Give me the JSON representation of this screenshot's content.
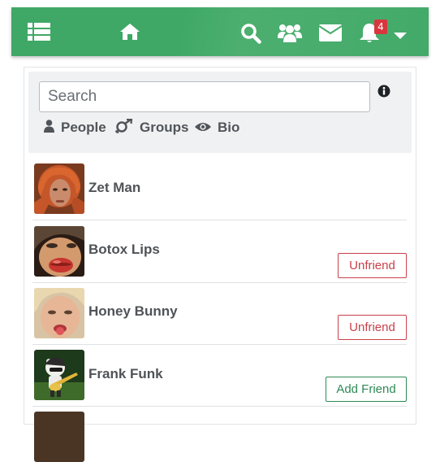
{
  "navbar": {
    "icons": [
      "list-icon",
      "home-icon",
      "search-icon",
      "users-icon",
      "envelope-icon",
      "bell-icon",
      "caret-down-icon"
    ],
    "notification_count": "4",
    "colors": {
      "bar": "#3fa866",
      "badge": "#d9363e"
    }
  },
  "search": {
    "placeholder": "Search",
    "value": ""
  },
  "filters": [
    {
      "label": "People",
      "icon": "user-icon"
    },
    {
      "label": "Groups",
      "icon": "gender-icon"
    },
    {
      "label": "Bio",
      "icon": "eye-icon"
    }
  ],
  "friends": [
    {
      "name": "Zet Man",
      "action": ""
    },
    {
      "name": "Botox Lips",
      "action": "Unfriend"
    },
    {
      "name": "Honey Bunny",
      "action": "Unfriend"
    },
    {
      "name": "Frank Funk",
      "action": "Add Friend"
    }
  ],
  "colors": {
    "unfriend": "#c9404a",
    "add_friend": "#2e8a57",
    "panel_bg": "#f0f1f3"
  }
}
